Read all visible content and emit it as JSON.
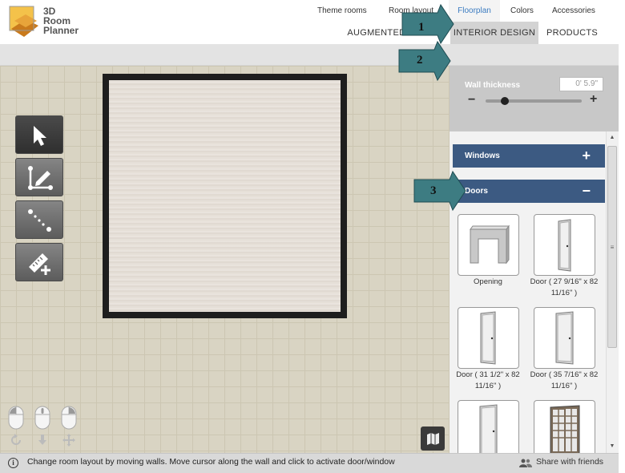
{
  "brand": {
    "line1": "3D",
    "line2": "Room",
    "line3": "Planner"
  },
  "topnav": {
    "augmented_reality": "AUGMENTED REALITY",
    "interior_design": "INTERIOR DESIGN",
    "products": "PRODUCTS"
  },
  "subnav": {
    "theme_rooms": "Theme rooms",
    "room_layout": "Room layout",
    "floorplan": "Floorplan",
    "colors": "Colors",
    "accessories": "Accessories"
  },
  "wall": {
    "label": "Wall thickness",
    "value": "0' 5.9\"",
    "minus": "−",
    "plus": "+",
    "slider_fraction": 0.2
  },
  "sections": {
    "windows": {
      "label": "Windows",
      "sign": "+"
    },
    "doors": {
      "label": "Doors",
      "sign": "−"
    }
  },
  "doors": [
    {
      "label": "Opening"
    },
    {
      "label": "Door ( 27 9/16\" x 82 11/16\" )"
    },
    {
      "label": "Door ( 31 1/2\" x 82 11/16\" )"
    },
    {
      "label": "Door ( 35 7/16\" x 82 11/16\" )"
    },
    {
      "label": ""
    },
    {
      "label": ""
    }
  ],
  "callouts": [
    "1",
    "2",
    "3"
  ],
  "status": {
    "info_icon": "i",
    "text": "Change room layout by moving walls. Move cursor along the wall and click to activate door/window",
    "share": "Share with friends"
  },
  "colors": {
    "accent_blue": "#3c5a82",
    "active_link": "#3a7bc0",
    "callout_teal": "#3d7c82"
  },
  "icons": [
    "logo-icon",
    "select-arrow-icon",
    "draw-wall-icon",
    "dotted-line-icon",
    "measure-ruler-icon",
    "mouse-left-icon",
    "mouse-middle-icon",
    "mouse-right-icon",
    "rotate-icon",
    "move-down-icon",
    "pan-icon",
    "map-icon",
    "info-icon",
    "share-people-icon"
  ]
}
